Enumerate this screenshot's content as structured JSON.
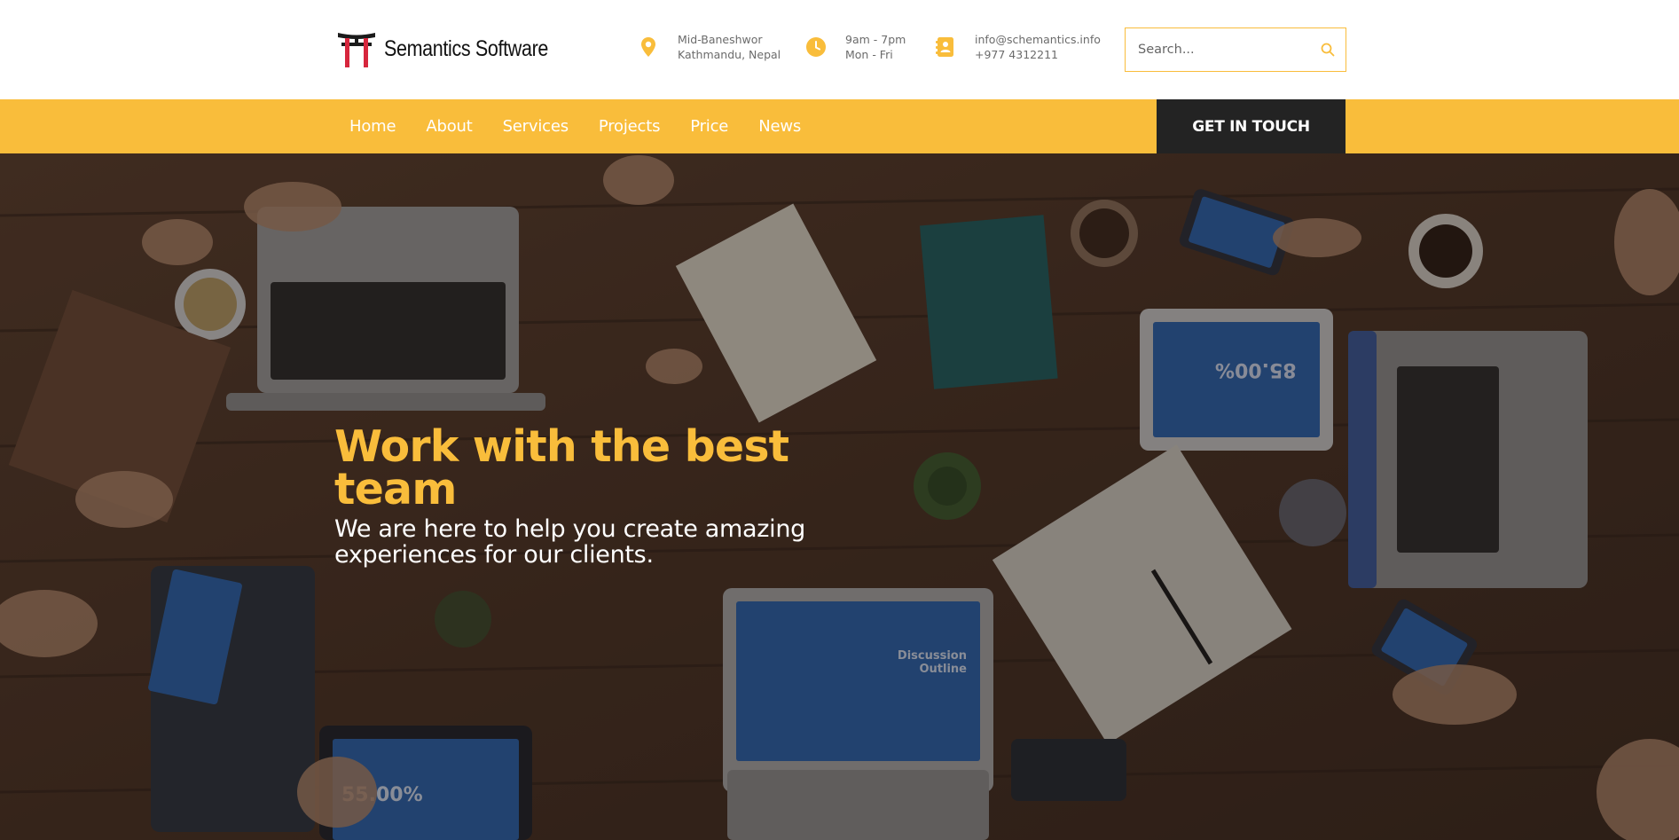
{
  "header": {
    "brand_name": "Semantics Software",
    "address": {
      "icon": "map-pin-icon",
      "line1": "Mid-Baneshwor",
      "line2": "Kathmandu, Nepal"
    },
    "hours": {
      "icon": "clock-icon",
      "line1": "9am - 7pm",
      "line2": "Mon - Fri"
    },
    "contact": {
      "icon": "contact-card-icon",
      "line1": "info@schemantics.info",
      "line2": "+977 4312211"
    },
    "search": {
      "placeholder": "Search...",
      "value": "",
      "icon": "search-icon"
    }
  },
  "nav": {
    "items": [
      {
        "label": "Home"
      },
      {
        "label": "About"
      },
      {
        "label": "Services"
      },
      {
        "label": "Projects"
      },
      {
        "label": "Price"
      },
      {
        "label": "News"
      }
    ],
    "cta_label": "GET IN TOUCH"
  },
  "hero": {
    "title": "Work with the best team",
    "subtitle": "We are here to help you create amazing experiences for our clients."
  },
  "colors": {
    "accent": "#f9bd3b",
    "dark": "#232323",
    "logo_red": "#d7263d"
  }
}
